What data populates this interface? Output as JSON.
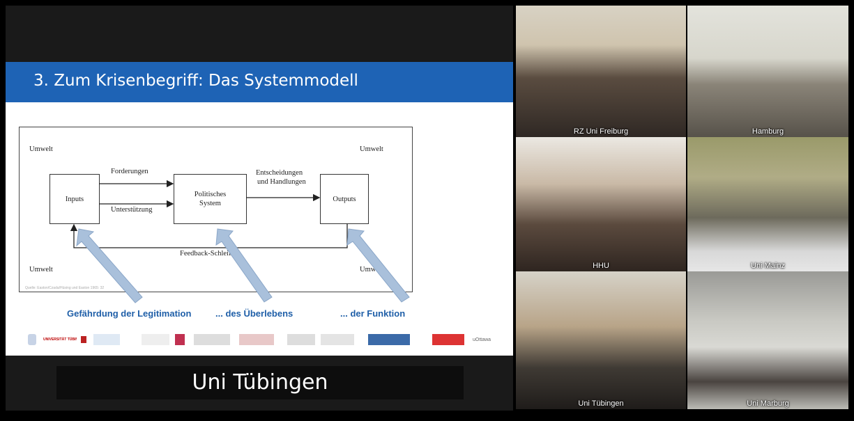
{
  "slide": {
    "title": "3. Zum Krisenbegriff: Das Systemmodell",
    "diagram": {
      "umwelt_top_left": "Umwelt",
      "umwelt_top_right": "Umwelt",
      "umwelt_bottom_left": "Umwelt",
      "umwelt_bottom_right": "Umwelt",
      "inputs": "Inputs",
      "system_line1": "Politisches",
      "system_line2": "System",
      "outputs": "Outputs",
      "forderungen": "Forderungen",
      "unterstuetzung": "Unterstützung",
      "entscheidungen_line1": "Entscheidungen",
      "entscheidungen_line2": "und Handlungen",
      "feedback": "Feedback-Schleife"
    },
    "source_note": "Quelle: Easton/Czada/Hüsing und Easton 1965: 32",
    "captions": {
      "legitimation": "Gefährdung der Legitimation",
      "ueberleben": "... des Überlebens",
      "funktion": "... der Funktion"
    },
    "logos": [
      {
        "name": "tuebingen-logo",
        "text": "UNIVERSITÄT TÜBINGEN"
      },
      {
        "name": "partner-logo-2",
        "text": ""
      },
      {
        "name": "partner-logo-3",
        "text": ""
      },
      {
        "name": "partner-logo-4",
        "text": ""
      },
      {
        "name": "partner-logo-5",
        "text": ""
      },
      {
        "name": "partner-logo-6",
        "text": ""
      },
      {
        "name": "partner-logo-7",
        "text": ""
      },
      {
        "name": "partner-logo-8",
        "text": ""
      },
      {
        "name": "partner-logo-9",
        "text": ""
      },
      {
        "name": "partner-logo-10",
        "text": ""
      },
      {
        "name": "ottawa-logo",
        "text": "uOttawa"
      }
    ]
  },
  "presenter": {
    "label": "Uni Tübingen"
  },
  "participants": [
    {
      "label": "RZ Uni Freiburg"
    },
    {
      "label": "Hamburg"
    },
    {
      "label": "HHU"
    },
    {
      "label": "Uni Mainz"
    },
    {
      "label": "Uni Tübingen"
    },
    {
      "label": "Uni Marburg"
    }
  ],
  "colors": {
    "slide_header": "#1e63b5",
    "caption_blue": "#1f5fa8",
    "arrow_fill": "#a9c0db"
  }
}
